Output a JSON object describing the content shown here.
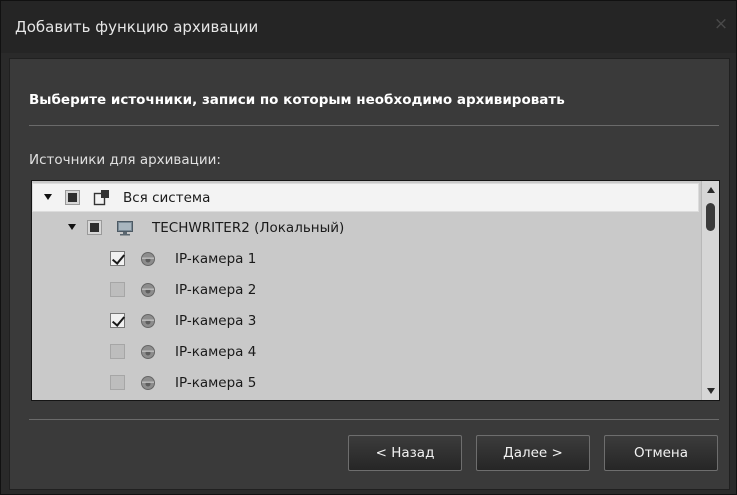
{
  "window": {
    "title": "Добавить функцию архивации",
    "close_glyph": "×"
  },
  "main": {
    "heading": "Выберите источники, записи по которым необходимо архивировать",
    "sources_label": "Источники для архивации:"
  },
  "tree": {
    "rows": [
      {
        "label": "Вся система",
        "state": "partial",
        "icon": "system-icon",
        "expanded": true
      },
      {
        "label": "TECHWRITER2 (Локальный)",
        "state": "partial",
        "icon": "computer-icon",
        "expanded": true
      },
      {
        "label": "IP-камера 1",
        "state": "checked",
        "icon": "camera-icon"
      },
      {
        "label": "IP-камера 2",
        "state": "unchecked",
        "icon": "camera-icon"
      },
      {
        "label": "IP-камера 3",
        "state": "checked",
        "icon": "camera-icon"
      },
      {
        "label": "IP-камера 4",
        "state": "unchecked",
        "icon": "camera-icon"
      },
      {
        "label": "IP-камера 5",
        "state": "unchecked",
        "icon": "camera-icon"
      }
    ]
  },
  "buttons": {
    "back": "< Назад",
    "next": "Далее >",
    "cancel": "Отмена"
  },
  "colors": {
    "title_bg": "#252525",
    "panel_bg": "#3a3a3a",
    "tree_bg": "#c9c9c9",
    "selected_row_bg": "#f3f3f3"
  }
}
